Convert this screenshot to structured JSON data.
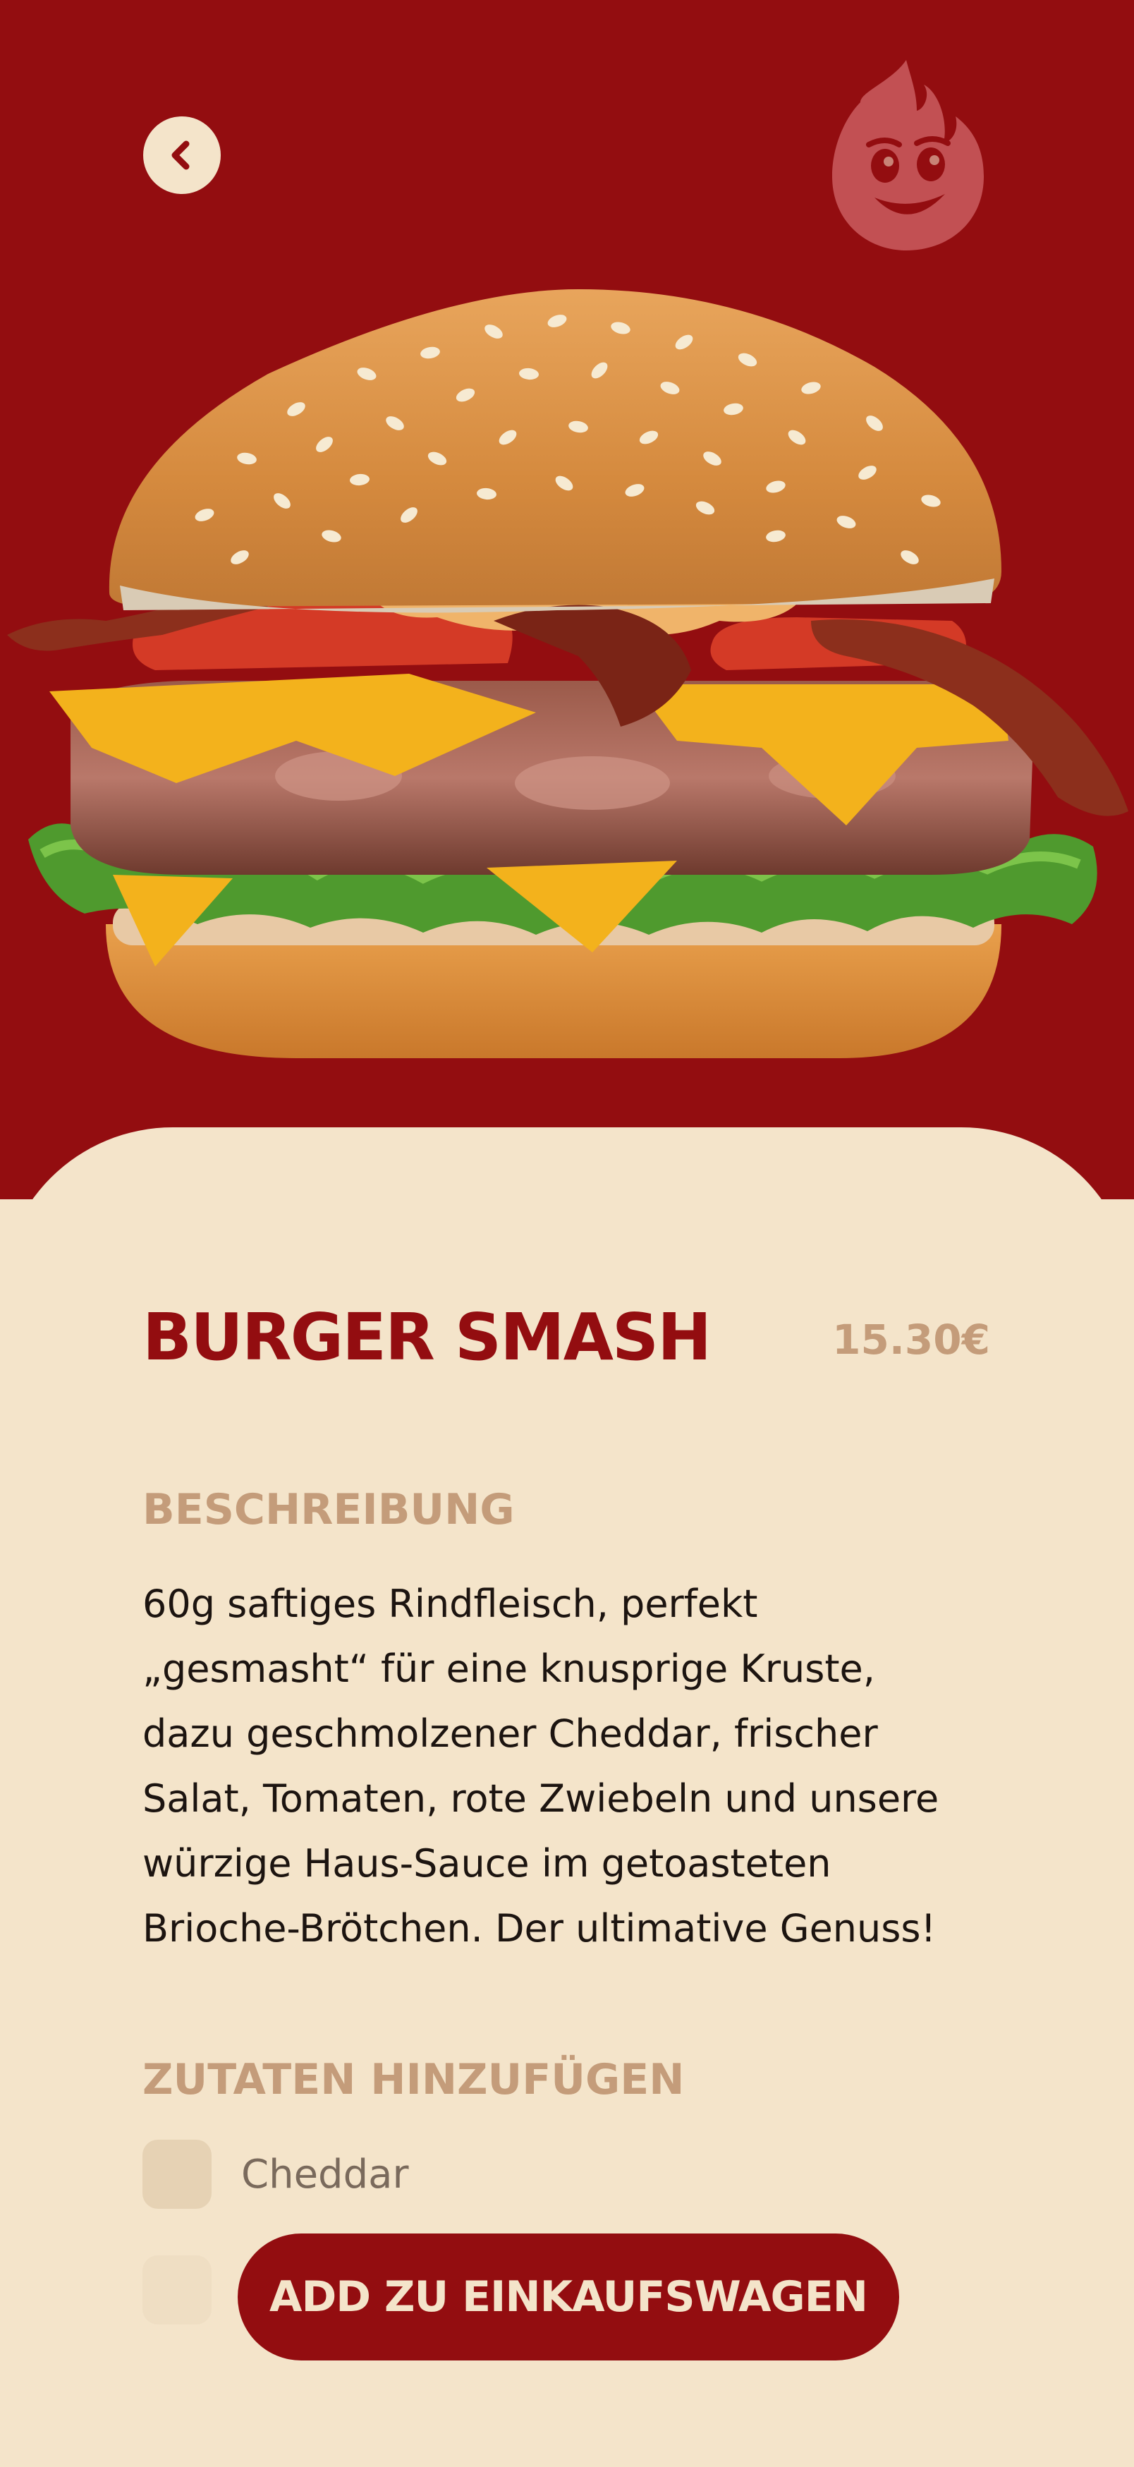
{
  "product": {
    "name": "BURGER SMASH",
    "price": "15.30€"
  },
  "description": {
    "heading": "BESCHREIBUNG",
    "text": "60g saftiges Rindfleisch, perfekt „gesmasht“ für eine knusprige Kruste, dazu geschmolzener Cheddar, frischer Salat, Tomaten, rote Zwiebeln und unsere würzige Haus-Sauce im getoasteten Brioche-Brötchen. Der ultimative Genuss!"
  },
  "extras": {
    "heading": "ZUTATEN HINZUFÜGEN",
    "options": [
      {
        "label": "Cheddar",
        "checked": false
      }
    ]
  },
  "cart": {
    "button_label": "ADD ZU EINKAUFSWAGEN"
  },
  "icons": {
    "back": "chevron-left-icon",
    "mascot": "flame-mascot-icon"
  },
  "colors": {
    "brand_red": "#930d10",
    "cream": "#f4e4ca",
    "accent_tan": "#c49c7a"
  }
}
